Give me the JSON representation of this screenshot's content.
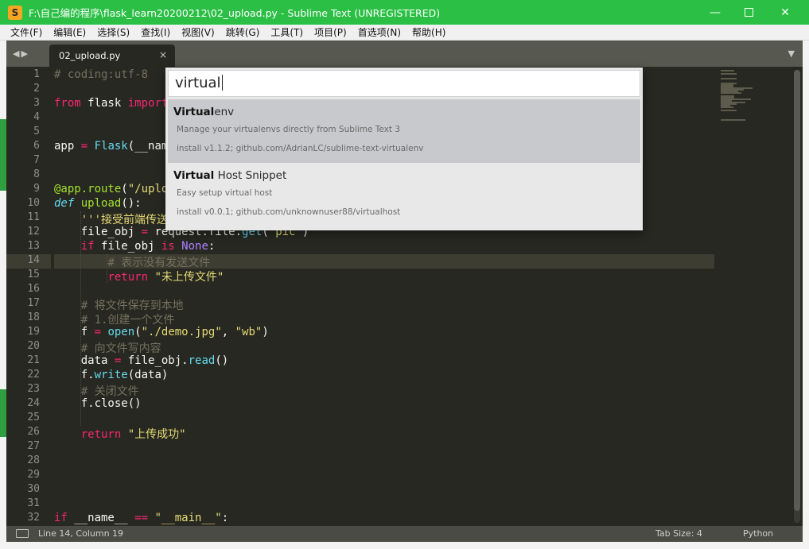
{
  "window": {
    "title": "F:\\自己编的程序\\flask_learn20200212\\02_upload.py - Sublime Text (UNREGISTERED)",
    "app_icon": "S",
    "minimize": "—",
    "close": "✕"
  },
  "menu": [
    "文件(F)",
    "编辑(E)",
    "选择(S)",
    "查找(I)",
    "视图(V)",
    "跳转(G)",
    "工具(T)",
    "项目(P)",
    "首选项(N)",
    "帮助(H)"
  ],
  "tabs": {
    "nav": "◀▶",
    "active": "02_upload.py",
    "close": "×",
    "menu": "▼"
  },
  "editor": {
    "current_line": 14,
    "lines": [
      {
        "n": "1",
        "tokens": [
          {
            "t": "# coding:utf-8",
            "c": "cmt"
          }
        ]
      },
      {
        "n": "2",
        "tokens": []
      },
      {
        "n": "3",
        "tokens": [
          {
            "t": "from",
            "c": "kw"
          },
          {
            "t": " flask ",
            "c": "plain"
          },
          {
            "t": "import",
            "c": "kw"
          }
        ]
      },
      {
        "n": "4",
        "tokens": []
      },
      {
        "n": "5",
        "tokens": []
      },
      {
        "n": "6",
        "tokens": [
          {
            "t": "app ",
            "c": "plain"
          },
          {
            "t": "=",
            "c": "kw"
          },
          {
            "t": " ",
            "c": "plain"
          },
          {
            "t": "Flask",
            "c": "builtin"
          },
          {
            "t": "(__nam",
            "c": "plain"
          }
        ]
      },
      {
        "n": "7",
        "tokens": []
      },
      {
        "n": "8",
        "tokens": []
      },
      {
        "n": "9",
        "tokens": [
          {
            "t": "@app.route",
            "c": "fn"
          },
          {
            "t": "(",
            "c": "plain"
          },
          {
            "t": "\"/uplo",
            "c": "str"
          }
        ]
      },
      {
        "n": "10",
        "tokens": [
          {
            "t": "def",
            "c": "def"
          },
          {
            "t": " ",
            "c": "plain"
          },
          {
            "t": "upload",
            "c": "fn"
          },
          {
            "t": "():",
            "c": "plain"
          }
        ]
      },
      {
        "n": "11",
        "tokens": [
          {
            "t": "    '''接受前端传送",
            "c": "str"
          }
        ]
      },
      {
        "n": "12",
        "tokens": [
          {
            "t": "    file_obj ",
            "c": "plain"
          },
          {
            "t": "=",
            "c": "kw"
          },
          {
            "t": " request.file.",
            "c": "plain"
          },
          {
            "t": "get",
            "c": "builtin"
          },
          {
            "t": "(",
            "c": "plain"
          },
          {
            "t": "\"pic\"",
            "c": "str"
          },
          {
            "t": ")",
            "c": "plain"
          }
        ]
      },
      {
        "n": "13",
        "tokens": [
          {
            "t": "    ",
            "c": "plain"
          },
          {
            "t": "if",
            "c": "kw"
          },
          {
            "t": " file_obj ",
            "c": "plain"
          },
          {
            "t": "is",
            "c": "kw"
          },
          {
            "t": " ",
            "c": "plain"
          },
          {
            "t": "None",
            "c": "const"
          },
          {
            "t": ":",
            "c": "plain"
          }
        ]
      },
      {
        "n": "14",
        "tokens": [
          {
            "t": "        # 表示没有发送文件",
            "c": "cmt"
          }
        ]
      },
      {
        "n": "15",
        "tokens": [
          {
            "t": "        ",
            "c": "plain"
          },
          {
            "t": "return",
            "c": "kw"
          },
          {
            "t": " ",
            "c": "plain"
          },
          {
            "t": "\"未上传文件\"",
            "c": "str"
          }
        ]
      },
      {
        "n": "16",
        "tokens": []
      },
      {
        "n": "17",
        "tokens": [
          {
            "t": "    # 将文件保存到本地",
            "c": "cmt"
          }
        ]
      },
      {
        "n": "18",
        "tokens": [
          {
            "t": "    # 1.创建一个文件",
            "c": "cmt"
          }
        ]
      },
      {
        "n": "19",
        "tokens": [
          {
            "t": "    f ",
            "c": "plain"
          },
          {
            "t": "=",
            "c": "kw"
          },
          {
            "t": " ",
            "c": "plain"
          },
          {
            "t": "open",
            "c": "builtin"
          },
          {
            "t": "(",
            "c": "plain"
          },
          {
            "t": "\"./demo.jpg\"",
            "c": "str"
          },
          {
            "t": ", ",
            "c": "plain"
          },
          {
            "t": "\"wb\"",
            "c": "str"
          },
          {
            "t": ")",
            "c": "plain"
          }
        ]
      },
      {
        "n": "20",
        "tokens": [
          {
            "t": "    # 向文件写内容",
            "c": "cmt"
          }
        ]
      },
      {
        "n": "21",
        "tokens": [
          {
            "t": "    data ",
            "c": "plain"
          },
          {
            "t": "=",
            "c": "kw"
          },
          {
            "t": " file_obj.",
            "c": "plain"
          },
          {
            "t": "read",
            "c": "builtin"
          },
          {
            "t": "()",
            "c": "plain"
          }
        ]
      },
      {
        "n": "22",
        "tokens": [
          {
            "t": "    f.",
            "c": "plain"
          },
          {
            "t": "write",
            "c": "builtin"
          },
          {
            "t": "(data)",
            "c": "plain"
          }
        ]
      },
      {
        "n": "23",
        "tokens": [
          {
            "t": "    # 关闭文件",
            "c": "cmt"
          }
        ]
      },
      {
        "n": "24",
        "tokens": [
          {
            "t": "    f.close()",
            "c": "plain"
          }
        ]
      },
      {
        "n": "25",
        "tokens": []
      },
      {
        "n": "26",
        "tokens": [
          {
            "t": "    ",
            "c": "plain"
          },
          {
            "t": "return",
            "c": "kw"
          },
          {
            "t": " ",
            "c": "plain"
          },
          {
            "t": "\"上传成功\"",
            "c": "str"
          }
        ]
      },
      {
        "n": "27",
        "tokens": []
      },
      {
        "n": "28",
        "tokens": []
      },
      {
        "n": "29",
        "tokens": []
      },
      {
        "n": "30",
        "tokens": []
      },
      {
        "n": "31",
        "tokens": []
      },
      {
        "n": "32",
        "tokens": [
          {
            "t": "if",
            "c": "kw"
          },
          {
            "t": " __name__ ",
            "c": "plain"
          },
          {
            "t": "==",
            "c": "kw"
          },
          {
            "t": " ",
            "c": "plain"
          },
          {
            "t": "\"__main__\"",
            "c": "str"
          },
          {
            "t": ":",
            "c": "plain"
          }
        ]
      }
    ]
  },
  "palette": {
    "query": "virtual",
    "results": [
      {
        "match": "Virtual",
        "rest": "env",
        "description": "Manage your virtualenvs directly from Sublime Text 3",
        "info": "install v1.1.2; github.com/AdrianLC/sublime-text-virtualenv",
        "selected": true
      },
      {
        "match": "Virtual",
        "rest": " Host Snippet",
        "description": "Easy setup virtual host",
        "info": "install v0.0.1; github.com/unknownuser88/virtualhost",
        "selected": false
      }
    ]
  },
  "status": {
    "position": "Line 14, Column 19",
    "tab_size": "Tab Size: 4",
    "syntax": "Python"
  },
  "colors": {
    "titlebar": "#2bbf45",
    "editor_bg": "#272822",
    "keyword": "#f92672",
    "string": "#e6db74",
    "comment": "#75715e",
    "function": "#a6e22e"
  }
}
